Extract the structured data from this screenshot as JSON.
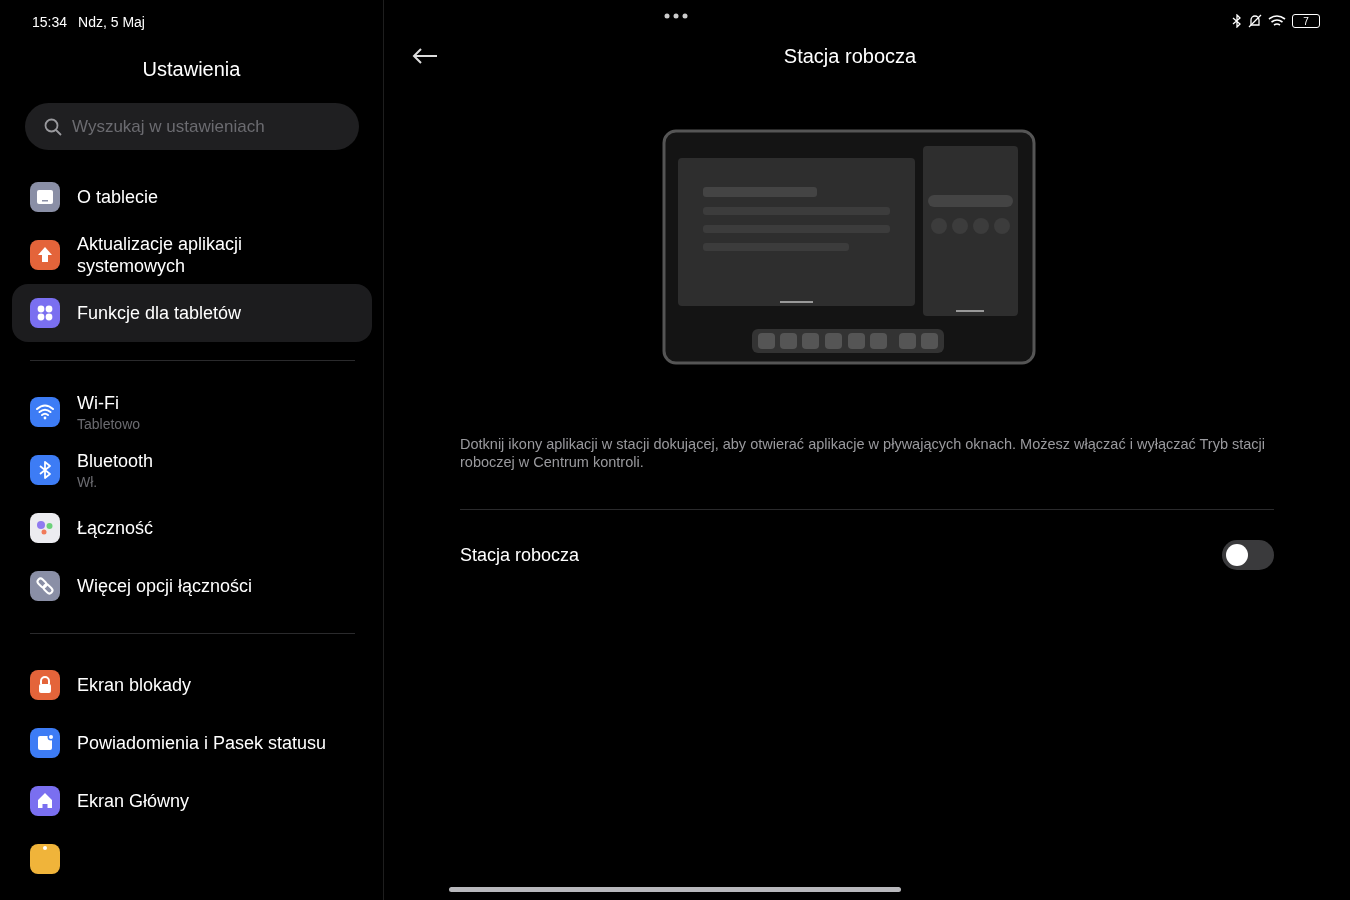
{
  "status_bar": {
    "time": "15:34",
    "date": "Ndz, 5 Maj",
    "battery": "7"
  },
  "sidebar": {
    "title": "Ustawienia",
    "search": {
      "placeholder": "Wyszukaj w ustawieniach"
    },
    "groups": [
      [
        {
          "kind": "tablet",
          "label": "O tablecie",
          "selected": false
        },
        {
          "kind": "update",
          "label": "Aktualizacje aplikacji systemowych",
          "selected": false
        },
        {
          "kind": "features",
          "label": "Funkcje dla tabletów",
          "selected": true
        }
      ],
      [
        {
          "kind": "wifi",
          "label": "Wi-Fi",
          "sublabel": "Tabletowo",
          "selected": false
        },
        {
          "kind": "bluetooth",
          "label": "Bluetooth",
          "sublabel": "Wł.",
          "selected": false
        },
        {
          "kind": "connectivity",
          "label": "Łączność",
          "selected": false
        },
        {
          "kind": "link",
          "label": "Więcej opcji łączności",
          "selected": false
        }
      ],
      [
        {
          "kind": "lock",
          "label": "Ekran blokady",
          "selected": false
        },
        {
          "kind": "notifications",
          "label": "Powiadomienia i Pasek statusu",
          "selected": false
        },
        {
          "kind": "home",
          "label": "Ekran Główny",
          "selected": false
        },
        {
          "kind": "partial",
          "selected": false
        }
      ]
    ]
  },
  "detail": {
    "title": "Stacja robocza",
    "description": "Dotknij ikony aplikacji w stacji dokującej, aby otwierać aplikacje w pływających oknach. Możesz włączać i wyłączać Tryb stacji roboczej w Centrum kontroli.",
    "setting": {
      "label": "Stacja robocza",
      "on": false
    }
  }
}
